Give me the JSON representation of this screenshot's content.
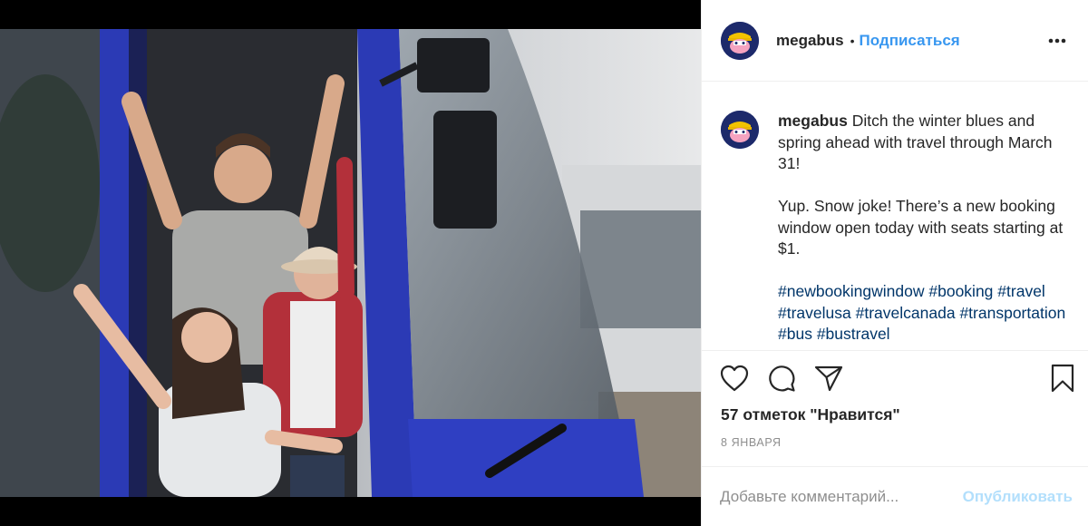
{
  "post": {
    "username": "megabus",
    "header_separator": "•",
    "follow_label": "Подписаться",
    "more_icon": "more-horizontal-icon",
    "caption_lines": [
      "Ditch the winter blues and spring ahead with travel through March 31!",
      "Yup. Snow joke! There’s a new booking window open today with seats starting at $1."
    ],
    "hashtags": [
      "#newbookingwindow",
      "#booking",
      "#travel",
      "#travelusa",
      "#travelcanada",
      "#transportation",
      "#bus",
      "#bustravel"
    ],
    "likes_text": "57 отметок \"Нравится\"",
    "date_text": "8 ЯНВАРЯ",
    "comment_placeholder": "Добавьте комментарий...",
    "publish_label": "Опубликовать"
  },
  "colors": {
    "link_blue": "#3897f0",
    "hashtag_blue": "#003569",
    "muted_gray": "#8e8e8e",
    "publish_disabled": "#b2dffc",
    "bus_blue": "#2b3ab5",
    "avatar_navy": "#1d2a6b"
  },
  "icons": {
    "like": "heart-icon",
    "comment": "comment-bubble-icon",
    "share": "paper-plane-icon",
    "save": "bookmark-icon"
  }
}
